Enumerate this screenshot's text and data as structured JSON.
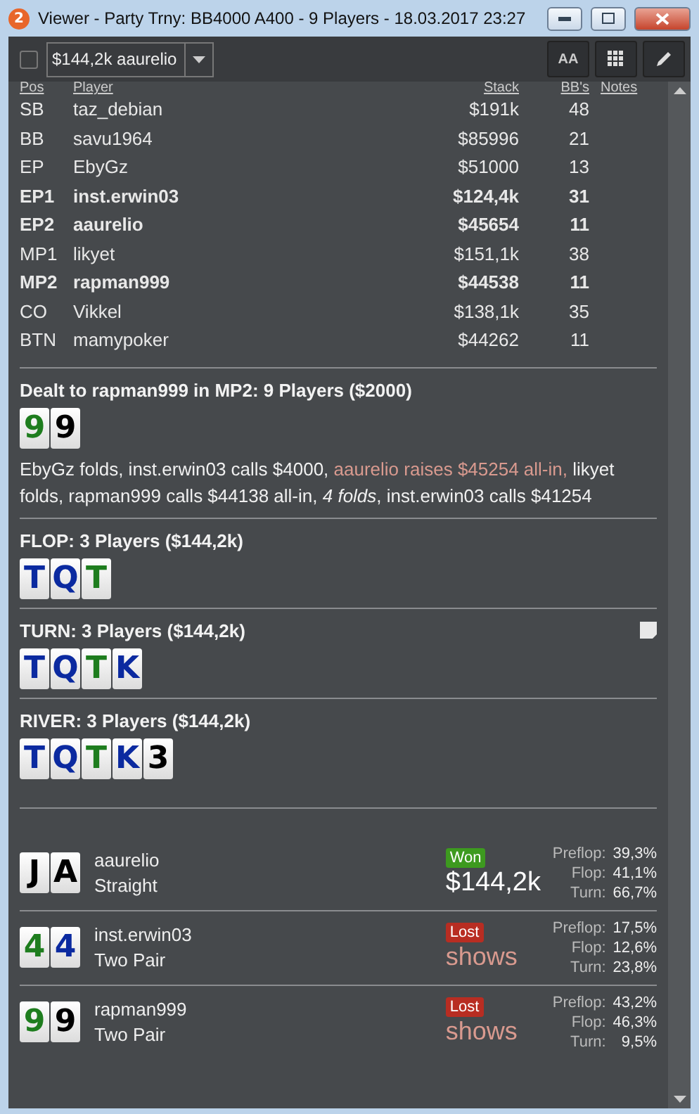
{
  "window": {
    "badge": "2",
    "title": "Viewer - Party Trny: BB4000 A400 - 9 Players - 18.03.2017 23:27"
  },
  "toolbar": {
    "checked": false,
    "hand_select": "$144,2k aaurelio",
    "font_button": "AA"
  },
  "players": {
    "columns": [
      "Pos",
      "Player",
      "Stack",
      "BB's",
      "Notes"
    ],
    "rows": [
      {
        "pos": "SB",
        "name": "taz_debian",
        "stack": "$191k",
        "bbs": "48",
        "in_hand": false
      },
      {
        "pos": "BB",
        "name": "savu1964",
        "stack": "$85996",
        "bbs": "21",
        "in_hand": false
      },
      {
        "pos": "EP",
        "name": "EbyGz",
        "stack": "$51000",
        "bbs": "13",
        "in_hand": false
      },
      {
        "pos": "EP1",
        "name": "inst.erwin03",
        "stack": "$124,4k",
        "bbs": "31",
        "in_hand": true
      },
      {
        "pos": "EP2",
        "name": "aaurelio",
        "stack": "$45654",
        "bbs": "11",
        "in_hand": true
      },
      {
        "pos": "MP1",
        "name": "likyet",
        "stack": "$151,1k",
        "bbs": "38",
        "in_hand": false
      },
      {
        "pos": "MP2",
        "name": "rapman999",
        "stack": "$44538",
        "bbs": "11",
        "in_hand": true
      },
      {
        "pos": "CO",
        "name": "Vikkel",
        "stack": "$138,1k",
        "bbs": "35",
        "in_hand": false
      },
      {
        "pos": "BTN",
        "name": "mamypoker",
        "stack": "$44262",
        "bbs": "11",
        "in_hand": false
      }
    ]
  },
  "streets": [
    {
      "title": "Dealt to rapman999 in MP2: 9 Players ($2000)",
      "note": false,
      "cards": [
        {
          "rank": "9",
          "color": "#1e7d1e"
        },
        {
          "rank": "9",
          "color": "#000000"
        }
      ],
      "actions": [
        {
          "text": "EbyGz folds, inst.erwin03 calls $4000, ",
          "kind": "plain"
        },
        {
          "text": "aaurelio raises $45254 all-in,",
          "kind": "raise"
        },
        {
          "text": " likyet folds, rapman999 calls $44138 all-in, *4 folds*, inst.erwin03 calls $41254",
          "kind": "plain"
        }
      ]
    },
    {
      "title": "FLOP: 3 Players ($144,2k)",
      "note": false,
      "cards": [
        {
          "rank": "T",
          "color": "#0b2aa0"
        },
        {
          "rank": "Q",
          "color": "#0b2aa0"
        },
        {
          "rank": "T",
          "color": "#1e7d1e"
        }
      ]
    },
    {
      "title": "TURN: 3 Players ($144,2k)",
      "note": true,
      "cards": [
        {
          "rank": "T",
          "color": "#0b2aa0"
        },
        {
          "rank": "Q",
          "color": "#0b2aa0"
        },
        {
          "rank": "T",
          "color": "#1e7d1e"
        },
        {
          "rank": "K",
          "color": "#0b2aa0"
        }
      ]
    },
    {
      "title": "RIVER: 3 Players ($144,2k)",
      "note": false,
      "cards": [
        {
          "rank": "T",
          "color": "#0b2aa0"
        },
        {
          "rank": "Q",
          "color": "#0b2aa0"
        },
        {
          "rank": "T",
          "color": "#1e7d1e"
        },
        {
          "rank": "K",
          "color": "#0b2aa0"
        },
        {
          "rank": "3",
          "color": "#000000"
        }
      ]
    }
  ],
  "results": [
    {
      "cards": [
        {
          "rank": "J",
          "color": "#000000"
        },
        {
          "rank": "A",
          "color": "#000000"
        }
      ],
      "name": "aaurelio",
      "hand": "Straight",
      "kind": "won",
      "badge": "Won",
      "amount": "$144,2k",
      "stats": [
        {
          "label": "Preflop:",
          "value": "39,3%"
        },
        {
          "label": "Flop:",
          "value": "41,1%"
        },
        {
          "label": "Turn:",
          "value": "66,7%"
        }
      ]
    },
    {
      "cards": [
        {
          "rank": "4",
          "color": "#1e7d1e"
        },
        {
          "rank": "4",
          "color": "#0b2aa0"
        }
      ],
      "name": "inst.erwin03",
      "hand": "Two Pair",
      "kind": "lost",
      "badge": "Lost",
      "amount": "shows",
      "stats": [
        {
          "label": "Preflop:",
          "value": "17,5%"
        },
        {
          "label": "Flop:",
          "value": "12,6%"
        },
        {
          "label": "Turn:",
          "value": "23,8%"
        }
      ]
    },
    {
      "cards": [
        {
          "rank": "9",
          "color": "#1e7d1e"
        },
        {
          "rank": "9",
          "color": "#000000"
        }
      ],
      "name": "rapman999",
      "hand": "Two Pair",
      "kind": "lost",
      "badge": "Lost",
      "amount": "shows",
      "stats": [
        {
          "label": "Preflop:",
          "value": "43,2%"
        },
        {
          "label": "Flop:",
          "value": "46,3%"
        },
        {
          "label": "Turn:",
          "value": "9,5%"
        }
      ]
    }
  ]
}
